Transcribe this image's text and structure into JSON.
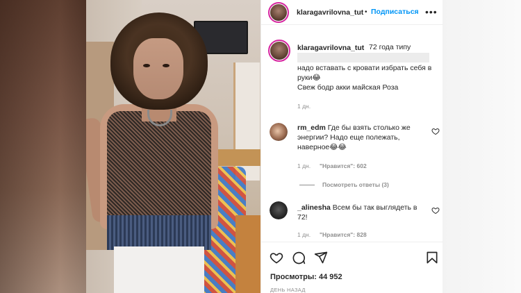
{
  "post": {
    "author": "klaragavrilovna_tut",
    "separator": "•",
    "follow_label": "Подписаться",
    "more_label": "•••"
  },
  "caption": {
    "author": "klaragavrilovna_tut",
    "line1": "72 года типу",
    "line2": "надо вставать с кровати избрать себя в",
    "line3": "руки😂",
    "line4": "Свеж бодр акки майская Роза",
    "time": "1 дн."
  },
  "comments": [
    {
      "author": "rm_edm",
      "line1": "Где бы взять столько же",
      "line2": "энергии? Надо еще полежать,",
      "line3": "наверное😂😂",
      "time": "1 дн.",
      "likes": "\"Нравится\": 602",
      "replies": "Посмотреть ответы (3)"
    },
    {
      "author": "_alinesha",
      "line1": "Всем бы так выглядеть в",
      "line2": "72!",
      "time": "1 дн.",
      "likes": "\"Нравится\": 828"
    }
  ],
  "footer": {
    "views": "Просмотры: 44 952",
    "ago": "ДЕНЬ НАЗАД"
  },
  "icons": {
    "like": "heart-icon",
    "comment": "comment-icon",
    "share": "send-icon",
    "save": "bookmark-icon"
  },
  "colors": {
    "accent": "#0095f6",
    "muted": "#8e8e8e",
    "text": "#262626"
  }
}
